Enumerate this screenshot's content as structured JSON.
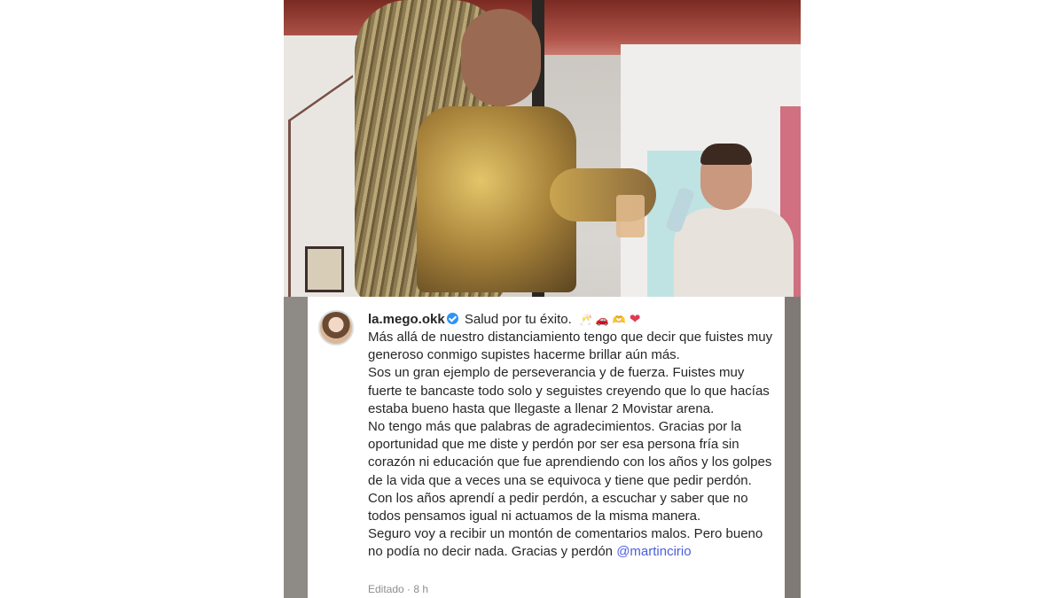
{
  "comment": {
    "username": "la.mego.okk",
    "first_line": "Salud por tu éxito.",
    "emojis": [
      "🥂",
      "🚗",
      "🫶",
      "❤"
    ],
    "paragraphs": [
      "Más allá de nuestro distanciamiento tengo que decir que fuistes muy generoso conmigo supistes hacerme brillar aún más.",
      "Sos un gran ejemplo de perseverancia y de fuerza. Fuistes muy fuerte te bancaste todo solo y seguistes creyendo que lo que hacías estaba bueno hasta que llegaste a llenar 2 Movistar arena.",
      "No tengo más que palabras de agradecimientos. Gracias por la oportunidad que me diste y perdón por ser esa persona fría sin corazón ni educación que fue aprendiendo con los años y los golpes de la vida que a veces una se equivoca y tiene que pedir perdón.",
      "Con los años aprendí a pedir perdón, a escuchar y saber que no todos pensamos igual ni actuamos de la misma manera.",
      "Seguro voy a recibir un montón de comentarios malos. Pero bueno no podía no decir nada. Gracias y perdón"
    ],
    "mention": "@martincirio",
    "meta": "Editado · 8 h"
  }
}
